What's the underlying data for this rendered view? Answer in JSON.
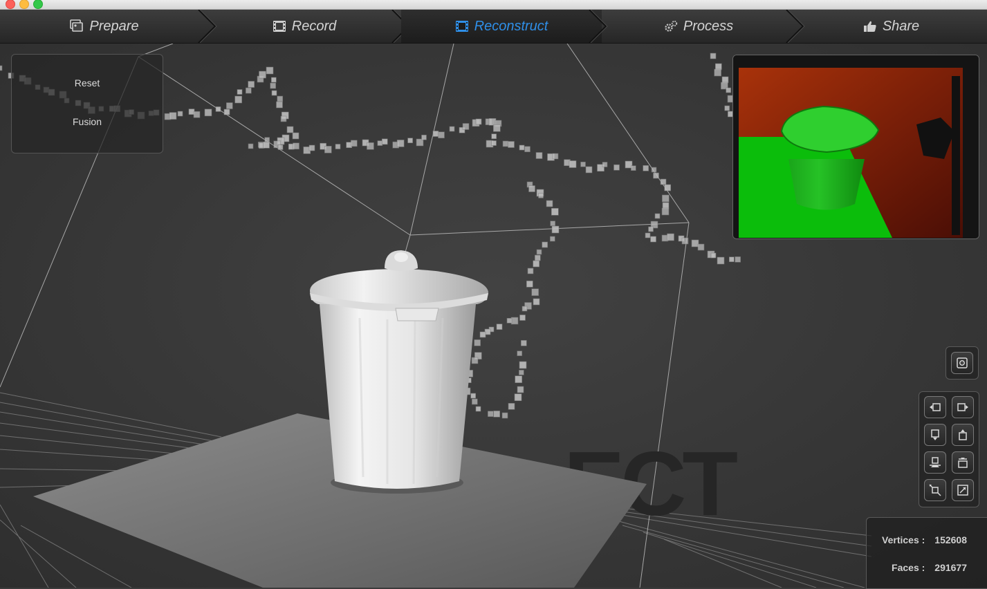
{
  "steps": [
    {
      "label": "Prepare",
      "icon": "prepare-icon"
    },
    {
      "label": "Record",
      "icon": "film-icon"
    },
    {
      "label": "Reconstruct",
      "icon": "film-icon",
      "active": true
    },
    {
      "label": "Process",
      "icon": "gears-icon"
    },
    {
      "label": "Share",
      "icon": "thumbs-up-icon"
    }
  ],
  "reset_panel": {
    "reset": "Reset",
    "fusion": "Fusion"
  },
  "stats": {
    "vertices_label": "Vertices :",
    "vertices_value": "152608",
    "faces_label": "Faces :",
    "faces_value": "291677"
  },
  "watermark": "ECT",
  "colors": {
    "accent": "#2f8fe8",
    "depth_green": "#00c400",
    "depth_red": "#8a1a0a"
  }
}
